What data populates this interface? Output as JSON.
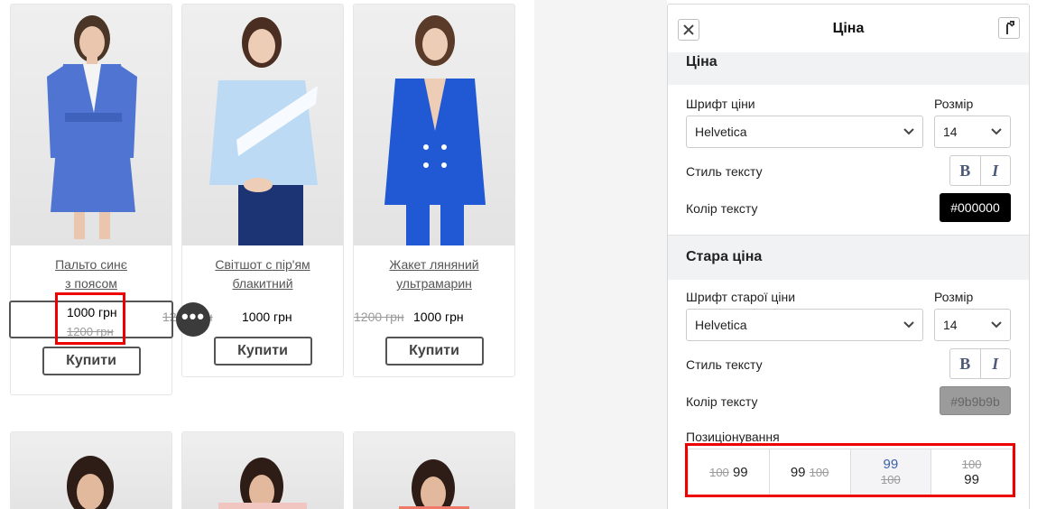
{
  "products": [
    {
      "name_line1": "Пальто синє",
      "name_line2": "з поясом",
      "price": "1000 грн",
      "old_price": "1200 грн",
      "buy_label": "Купити"
    },
    {
      "name_line1": "Світшот с пір'ям",
      "name_line2": "блакитний",
      "price": "1000 грн",
      "old_price": "1200 грн",
      "buy_label": "Купити"
    },
    {
      "name_line1": "Жакет ляняний",
      "name_line2": "ультрамарин",
      "price": "1000 грн",
      "old_price": "1200 грн",
      "buy_label": "Купити"
    }
  ],
  "dots_label": "•••",
  "panel": {
    "title": "Ціна",
    "close_icon": "close-icon",
    "pin_icon": "pin-icon",
    "section_price": {
      "title": "Ціна",
      "font_label": "Шрифт ціни",
      "font_value": "Helvetica",
      "size_label": "Розмір",
      "size_value": "14",
      "style_label": "Стиль тексту",
      "bold": "B",
      "italic": "I",
      "color_label": "Колір тексту",
      "color_value": "#000000"
    },
    "section_old_price": {
      "title": "Стара ціна",
      "font_label": "Шрифт старої ціни",
      "font_value": "Helvetica",
      "size_label": "Розмір",
      "size_value": "14",
      "style_label": "Стиль тексту",
      "bold": "B",
      "italic": "I",
      "color_label": "Колір тексту",
      "color_value": "#9b9b9b"
    },
    "positioning": {
      "label": "Позиціонування",
      "options": [
        {
          "old": "100",
          "new": "99"
        },
        {
          "new": "99",
          "old": "100"
        },
        {
          "new": "99",
          "old": "100"
        },
        {
          "old": "100",
          "new": "99"
        }
      ]
    }
  },
  "colors": {
    "accent_red": "#e00000",
    "panel_bg": "#f1f2f4",
    "link_blue": "#3b5fa8"
  }
}
